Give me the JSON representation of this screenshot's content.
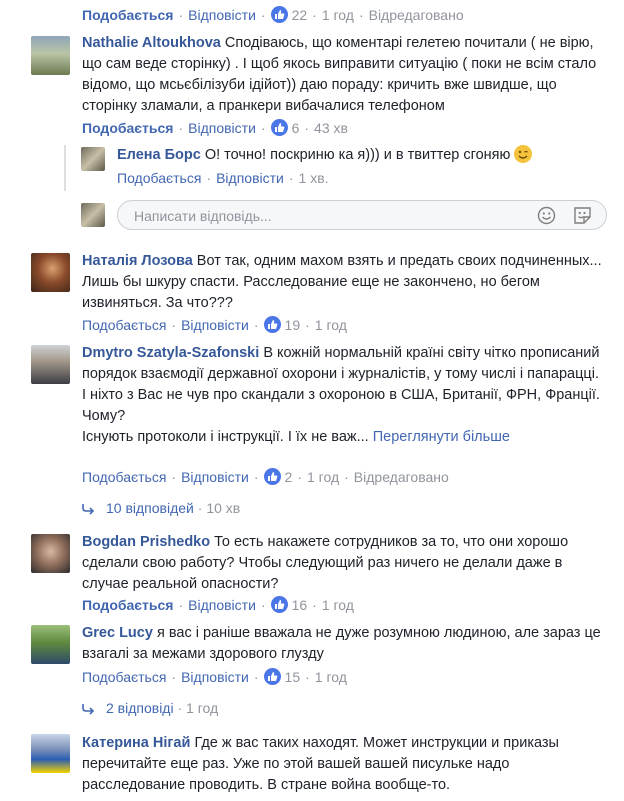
{
  "comments": [
    {
      "author": "",
      "text": "",
      "like_label": "Подобається",
      "reply_label": "Відповісти",
      "likes": "22",
      "time": "1 год",
      "edited": "Відредаговано"
    },
    {
      "author": "Nathalie Altoukhova",
      "text": "Сподіваюсь, що коментарі гелетею почитали ( не вірю, що сам веде сторінку) . І щоб якось виправити ситуацію ( поки не всім стало відомо, що мсьєбілізуби ідійот)) даю пораду: кричить вже швидше, що сторінку зламали, а пранкери вибачалися телефоном",
      "like_label": "Подобається",
      "reply_label": "Відповісти",
      "likes": "6",
      "time": "43 хв"
    },
    {
      "author": "Наталія Лозова",
      "text": "Вот так, одним махом взять и предать своих подчиненных... Лишь бы шкуру спасти. Расследование еще не закончено, но бегом извиняться. За что???",
      "like_label": "Подобається",
      "reply_label": "Відповісти",
      "likes": "19",
      "time": "1 год"
    },
    {
      "author": "Dmytro Szatyla-Szafonski",
      "text": "В кожній нормальній країні світу чітко прописаний порядок взаємодії державної охорони і журналістів, у тому числі і папарацці. І ніхто з Вас не чув про скандали з охороною в США, Британії, ФРН, Франції.",
      "text2": "Чому?",
      "text3": "Існують протоколи і інструкції. І їх не важ...",
      "see_more": "Переглянути більше",
      "like_label": "Подобається",
      "reply_label": "Відповісти",
      "likes": "2",
      "time": "1 год",
      "edited": "Відредаговано",
      "replies_label": "10 відповідей",
      "replies_time": "10 хв"
    },
    {
      "author": "Bogdan Prishedko",
      "text": "То есть накажете сотрудников за то, что они хорошо сделали свою работу? Чтобы следующий раз ничего не делали даже в случае реальной опасности?",
      "like_label": "Подобається",
      "reply_label": "Відповісти",
      "likes": "16",
      "time": "1 год"
    },
    {
      "author": "Grec Lucy",
      "text": "я вас і раніше вважала не дуже розумною людиною, але зараз це взагалі за межами здорового глузду",
      "like_label": "Подобається",
      "reply_label": "Відповісти",
      "likes": "15",
      "time": "1 год",
      "replies_label": "2 відповіді",
      "replies_time": "1 год"
    },
    {
      "author": "Катерина Нігай",
      "text": "Где ж вас таких находят. Может инструкции и приказы перечитайте еще раз. Уже по этой вашей вашей писульке надо расследование проводить. В стране война вообще-то."
    }
  ],
  "reply": {
    "author": "Елена Борс",
    "text": "О! точно! поскриню ка я))) и в твиттер сгоняю",
    "like_label": "Подобається",
    "reply_label": "Відповісти",
    "time": "1 хв."
  },
  "reply_box": {
    "placeholder": "Написати відповідь..."
  },
  "icons": {
    "like": "like-icon",
    "emoji": "emoji-icon",
    "sticker": "sticker-icon",
    "reply_arrow": "reply-arrow-icon"
  },
  "colors": {
    "link": "#4267b2",
    "author": "#365899",
    "muted": "#90949c",
    "like_badge": "#4a76e8"
  }
}
